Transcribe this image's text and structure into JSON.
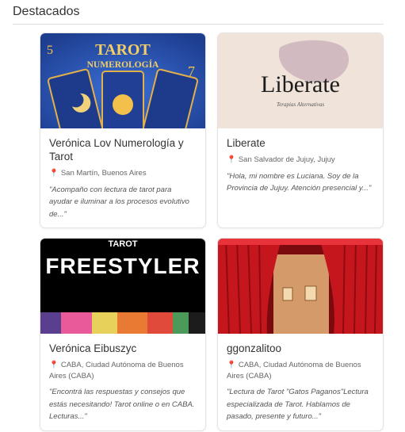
{
  "section": {
    "title": "Destacados"
  },
  "cards": [
    {
      "name": "Verónica Lov Numerología y Tarot",
      "location": "San Martín, Buenos Aires",
      "description": "\"Acompaño con lectura de tarot para ayudar e iluminar a los procesos evolutivo de...\"",
      "image_text": [
        "TAROT",
        "NUMEROLOGÍA"
      ]
    },
    {
      "name": "Liberate",
      "location": "San Salvador de Jujuy, Jujuy",
      "description": "\"Hola, mi nombre es Luciana. Soy de la Provincia de Jujuy. Atención presencial y...\"",
      "image_text": [
        "Liberate",
        "Terapias Alternativas"
      ]
    },
    {
      "name": "Verónica Eibuszyc",
      "location": "CABA, Ciudad Autónoma de Buenos Aires (CABA)",
      "description": "\"Encontrá las respuestas y consejos que estás necesitando! Tarot online o en CABA. Lecturas...\"",
      "image_text": [
        "TAROT",
        "FREESTYLER"
      ]
    },
    {
      "name": "ggonzalitoo",
      "location": "CABA, Ciudad Autónoma de Buenos Aires (CABA)",
      "description": "\"Lectura de Tarot \"Gatos Paganos\"Lectura especializada de Tarot. Hablamos de pasado, presente y futuro...\"",
      "image_text": []
    }
  ],
  "icons": {
    "location": "pin-icon"
  },
  "colors": {
    "pin": "#e0504a",
    "border": "#e3e3e3",
    "tarot_bg": "#2b56b4",
    "liberate_bg": "#efe3da",
    "curtain": "#c4161c"
  }
}
